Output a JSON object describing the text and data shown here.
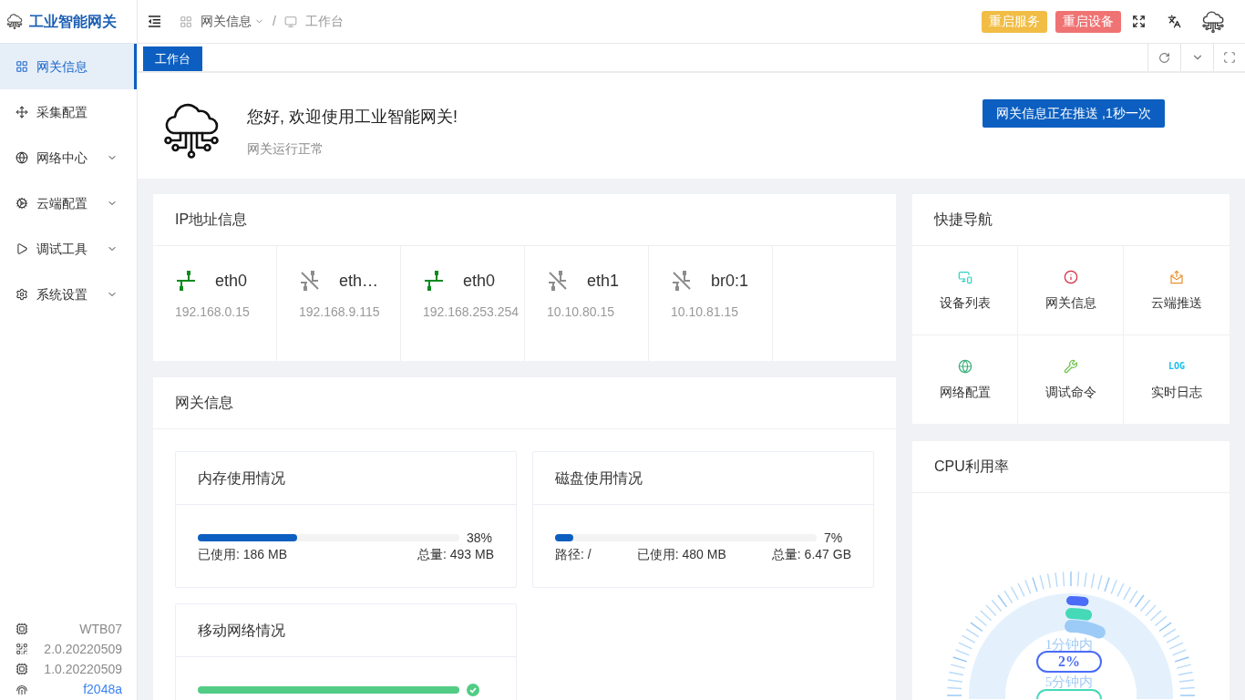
{
  "app": {
    "title": "工业智能网关"
  },
  "sidebar": {
    "items": [
      {
        "label": "网关信息",
        "kind": "link",
        "selected": true
      },
      {
        "label": "采集配置",
        "kind": "link",
        "selected": false
      },
      {
        "label": "网络中心",
        "kind": "group",
        "selected": false
      },
      {
        "label": "云端配置",
        "kind": "group",
        "selected": false
      },
      {
        "label": "调试工具",
        "kind": "group",
        "selected": false
      },
      {
        "label": "系统设置",
        "kind": "group",
        "selected": false
      }
    ],
    "device_info": [
      {
        "value": "WTB07",
        "kind": "text"
      },
      {
        "value": "2.0.20220509",
        "kind": "text"
      },
      {
        "value": "1.0.20220509",
        "kind": "text"
      },
      {
        "value": "f2048a",
        "kind": "link"
      }
    ]
  },
  "header": {
    "breadcrumb": [
      {
        "label": "网关信息",
        "kind": "menu"
      },
      {
        "label": "工作台",
        "kind": "page"
      }
    ],
    "separator": "/",
    "buttons": [
      {
        "label": "重启服务",
        "kind": "warning"
      },
      {
        "label": "重启设备",
        "kind": "danger"
      }
    ]
  },
  "tabs": [
    {
      "label": "工作台",
      "selected": true
    }
  ],
  "welcome": {
    "title": "您好, 欢迎使用工业智能网关!",
    "subtitle": "网关运行正常",
    "push_status": "网关信息正在推送 ,1秒一次"
  },
  "ip_info": {
    "title": "IP地址信息",
    "interfaces": [
      {
        "name": "eth0",
        "address": "192.168.0.15",
        "connected": true
      },
      {
        "name": "eth…",
        "address": "192.168.9.115",
        "connected": false
      },
      {
        "name": "eth0",
        "address": "192.168.253.254",
        "connected": true
      },
      {
        "name": "eth1",
        "address": "10.10.80.15",
        "connected": false
      },
      {
        "name": "br0:1",
        "address": "10.10.81.15",
        "connected": false
      }
    ]
  },
  "gateway_info": {
    "title": "网关信息",
    "memory": {
      "title": "内存使用情况",
      "level": 0.38,
      "percent": "38%",
      "used": "已使用: 186 MB",
      "total": "总量: 493 MB"
    },
    "disk": {
      "title": "磁盘使用情况",
      "level": 0.07,
      "percent": "7%",
      "path": "路径: /",
      "used": "已使用: 480 MB",
      "total": "总量: 6.47 GB"
    },
    "mobile": {
      "title": "移动网络情况",
      "level": 1,
      "complete": true
    }
  },
  "quick_nav": {
    "title": "快捷导航",
    "items": [
      {
        "label": "设备列表"
      },
      {
        "label": "网关信息"
      },
      {
        "label": "云端推送"
      },
      {
        "label": "网络配置"
      },
      {
        "label": "调试命令"
      },
      {
        "label": "实时日志",
        "badge": "LOG"
      }
    ]
  },
  "cpu": {
    "title": "CPU利用率",
    "readings": [
      {
        "caption": "1分钟内",
        "value": "2%"
      },
      {
        "caption": "5分钟内"
      }
    ]
  }
}
